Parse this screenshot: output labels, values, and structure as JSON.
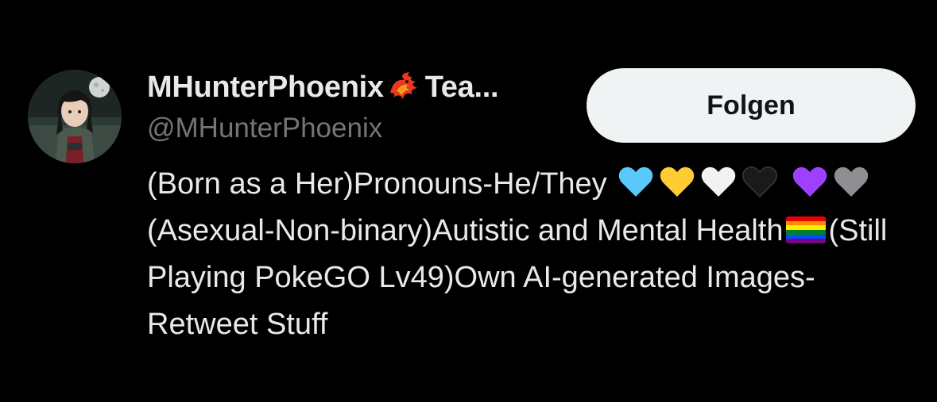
{
  "profile": {
    "display_name": "MHunterPhoenix",
    "name_truncated_suffix": "Tea...",
    "handle": "@MHunterPhoenix",
    "avatar_icon": "anime-avatar-icon",
    "name_emoji_icon": "phoenix-emoji-icon"
  },
  "actions": {
    "follow_label": "Folgen"
  },
  "bio": {
    "part1": "(Born as a Her)Pronouns-He/They ",
    "part2": "(Asexual-Non-binary)Autistic and Mental Health",
    "part3": "(Still Playing PokeGO Lv49)Own AI-generated Images-Retweet Stuff",
    "hearts_row1": [
      "light-blue-heart-icon",
      "yellow-heart-icon",
      "white-heart-icon",
      "black-heart-icon"
    ],
    "hearts_row2": [
      "purple-heart-icon",
      "grey-heart-icon"
    ],
    "flag_icon": "rainbow-flag-icon"
  },
  "colors": {
    "background": "#000000",
    "primary_text": "#e7e9ea",
    "secondary_text": "#71767b",
    "button_bg": "#eff3f4",
    "button_text": "#0f1419",
    "heart_light_blue": "#5ac8fa",
    "heart_yellow": "#ffcc33",
    "heart_white": "#f2f2f2",
    "heart_black": "#1a1a1a",
    "heart_purple": "#a040ff",
    "heart_grey": "#8e8e93"
  }
}
